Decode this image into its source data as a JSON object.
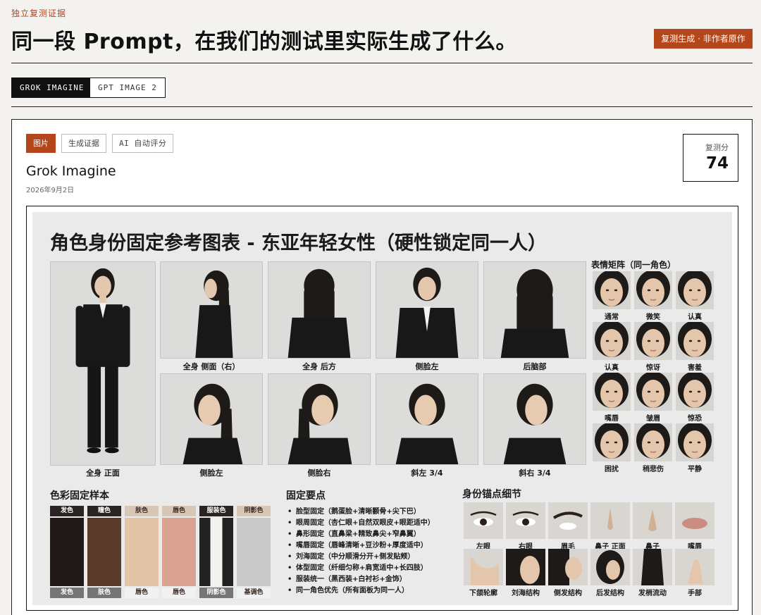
{
  "header": {
    "kicker": "独立复测证据",
    "title": "同一段 Prompt，在我们的测试里实际生成了什么。",
    "badge": "复测生成 · 非作者原作"
  },
  "model_tabs": [
    {
      "label": "GROK IMAGINE",
      "active": true
    },
    {
      "label": "GPT IMAGE 2",
      "active": false
    }
  ],
  "card": {
    "chips": [
      {
        "label": "图片",
        "active": true
      },
      {
        "label": "生成证据",
        "active": false
      },
      {
        "label": "AI 自动评分",
        "active": false
      }
    ],
    "model_name": "Grok Imagine",
    "date": "2026年9月2日",
    "score_label": "复测分",
    "score_value": "74"
  },
  "sheet": {
    "title": "角色身份固定参考图表 - 东亚年轻女性（硬性锁定同一人）",
    "views_top": [
      "全身 侧面（右）",
      "全身 后方",
      "侧脸左",
      "后脑部"
    ],
    "view_full": "全身 正面",
    "views_bottom": [
      "侧脸左",
      "侧脸右",
      "斜左 3/4",
      "斜右 3/4"
    ],
    "expression_title": "表情矩阵（同一角色）",
    "expressions": [
      "通常",
      "微笑",
      "认真",
      "认真",
      "惊讶",
      "害羞",
      "嘴唇",
      "皱眉",
      "惊恐",
      "困扰",
      "稍悲伤",
      "平静"
    ],
    "color_title": "色彩固定样本",
    "swatches": [
      {
        "top": "发色",
        "bottom": "发色",
        "color": "#1f1a17"
      },
      {
        "top": "瞳色",
        "bottom": "肤色",
        "color": "#5a3b2a"
      },
      {
        "top": "肤色",
        "bottom": "唇色",
        "color": "#e3c4a6"
      },
      {
        "top": "唇色",
        "bottom": "唇色",
        "color": "#d9a293"
      },
      {
        "top": "服装色",
        "bottom": "阴影色",
        "color": "#2a2a2a"
      },
      {
        "top": "阴影色",
        "bottom": "基调色",
        "color": "#c9c9c9"
      }
    ],
    "key_title": "固定要点",
    "key_points": [
      "脸型固定（鹅蛋脸+清晰颧骨+尖下巴）",
      "眼周固定（杏仁眼+自然双眼皮+眼距适中）",
      "鼻形固定（直鼻梁+精致鼻尖+窄鼻翼）",
      "嘴唇固定（唇峰清晰+豆沙粉+厚度适中）",
      "刘海固定（中分顺滑分开+侧发贴颊）",
      "体型固定（纤细匀称+肩宽适中+长四肢）",
      "服装统一（黑西装+白衬衫+金饰）",
      "同一角色优先（所有面板为同一人）"
    ],
    "detail_title": "身份锚点细节",
    "details": [
      "左眼",
      "右眼",
      "眉毛",
      "鼻子 正面",
      "鼻子",
      "嘴唇",
      "下颌轮廓",
      "刘海结构",
      "侧发结构",
      "后发结构",
      "发梢流动",
      "手部"
    ]
  }
}
